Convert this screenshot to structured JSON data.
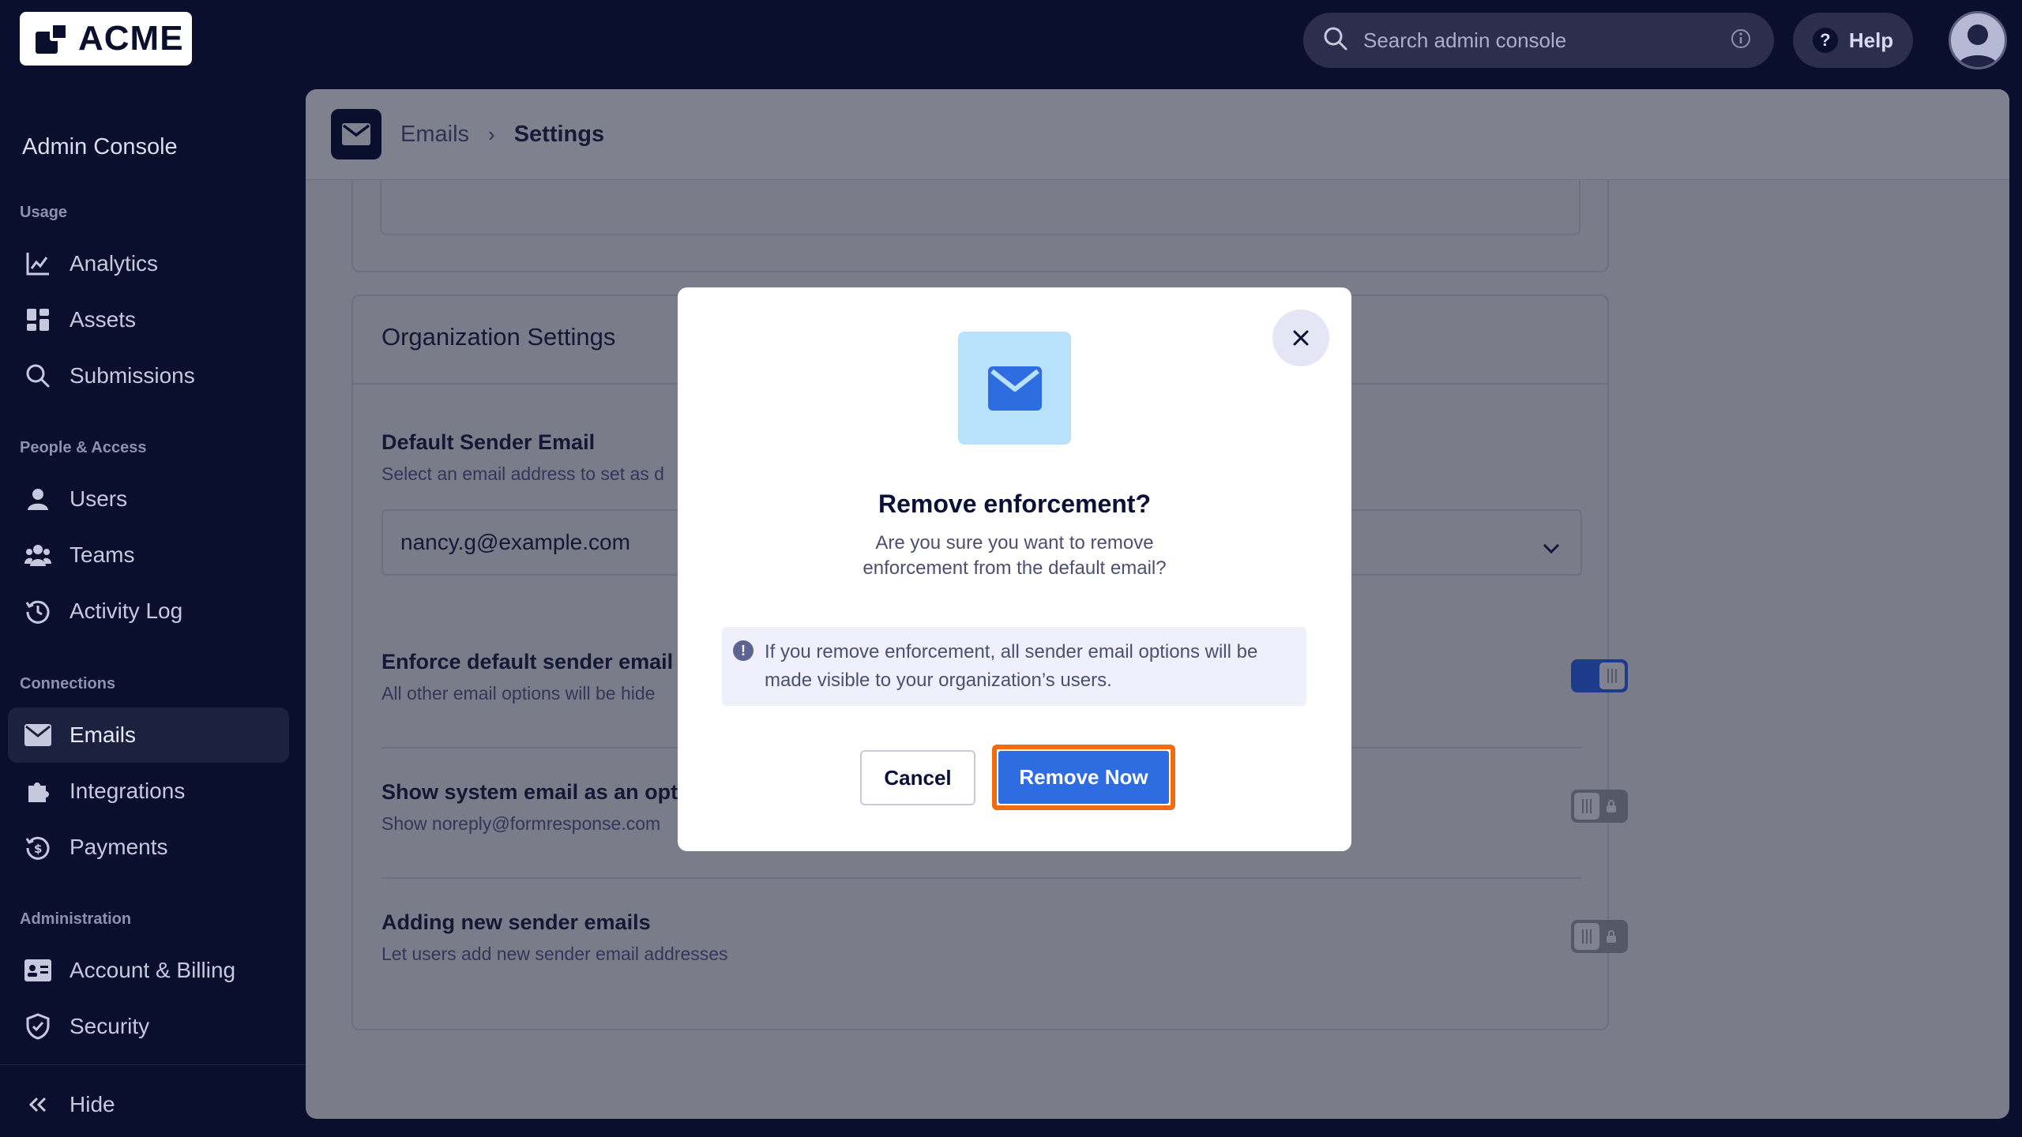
{
  "brand": {
    "logo_text": "ACME"
  },
  "topbar": {
    "search_placeholder": "Search admin console",
    "help_label": "Help",
    "help_symbol": "?"
  },
  "sidebar": {
    "title": "Admin Console",
    "sections": {
      "usage": "Usage",
      "people": "People & Access",
      "connections": "Connections",
      "administration": "Administration"
    },
    "items": {
      "analytics": "Analytics",
      "assets": "Assets",
      "submissions": "Submissions",
      "users": "Users",
      "teams": "Teams",
      "activity_log": "Activity Log",
      "emails": "Emails",
      "integrations": "Integrations",
      "payments": "Payments",
      "account_billing": "Account & Billing",
      "security": "Security"
    },
    "hide_label": "Hide",
    "active_item": "Emails"
  },
  "header": {
    "breadcrumb_parent": "Emails",
    "breadcrumb_separator": "›",
    "breadcrumb_current": "Settings"
  },
  "org_settings": {
    "title": "Organization Settings",
    "default_sender": {
      "label": "Default Sender Email",
      "description": "Select an email address to set as d",
      "value": "nancy.g@example.com"
    },
    "enforce": {
      "label": "Enforce default sender email",
      "description": "All other email options will be hide",
      "enabled": true
    },
    "system_email": {
      "label": "Show system email as an opt",
      "description": "Show noreply@formresponse.com",
      "enabled": false
    },
    "new_senders": {
      "label": "Adding new sender emails",
      "description": "Let users add new sender email addresses",
      "enabled": false
    }
  },
  "modal": {
    "title": "Remove enforcement?",
    "message": "Are you sure you want to remove enforcement from the default email?",
    "note": "If you remove enforcement, all sender email options will be made visible to your organization’s users.",
    "note_icon_symbol": "!",
    "cancel_label": "Cancel",
    "confirm_label": "Remove Now"
  },
  "colors": {
    "background": "#0b0f2e",
    "primary_button": "#2d6de1",
    "highlight_outline": "#f26b0f",
    "modal_icon_bg": "#b8e1fb"
  }
}
